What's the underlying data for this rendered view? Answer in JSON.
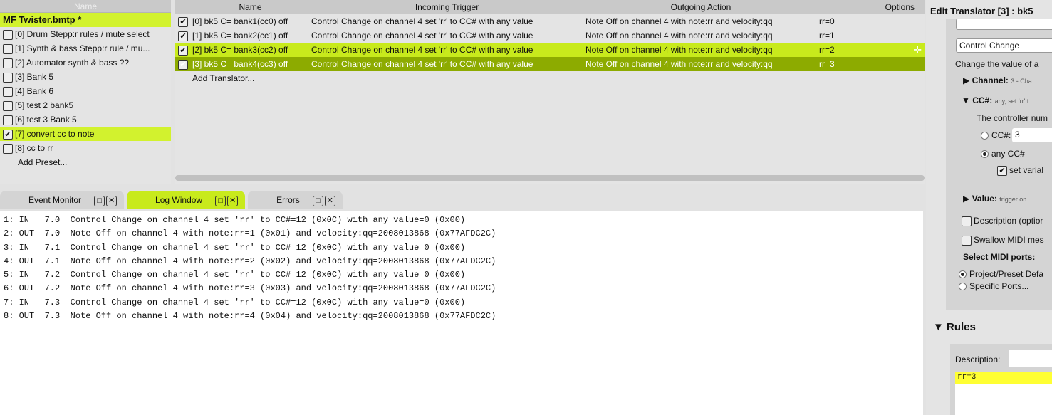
{
  "presets": {
    "header": "Name",
    "project": "MF Twister.bmtp *",
    "items": [
      {
        "label": "[0] Drum Stepp:r rules / mute select",
        "checked": false
      },
      {
        "label": "[1] Synth & bass Stepp:r rule / mu...",
        "checked": false
      },
      {
        "label": "[2] Automator synth & bass ??",
        "checked": false
      },
      {
        "label": "[3] Bank 5",
        "checked": false
      },
      {
        "label": "[4] Bank 6",
        "checked": false
      },
      {
        "label": "[5] test 2 bank5",
        "checked": false
      },
      {
        "label": "[6] test 3 Bank 5",
        "checked": false
      },
      {
        "label": "[7] convert cc to note",
        "checked": true,
        "selected": true
      },
      {
        "label": "[8] cc to rr",
        "checked": false
      }
    ],
    "add_label": "Add Preset..."
  },
  "translators": {
    "columns": [
      "Name",
      "Incoming Trigger",
      "Outgoing Action",
      "Options"
    ],
    "rows": [
      {
        "name": "[0] bk5 C= bank1(cc0) off",
        "incoming": "Control Change on channel 4 set 'rr' to CC# with any value",
        "outgoing": "Note Off on channel 4 with note:rr and velocity:qq",
        "options": "rr=0",
        "checked": true,
        "state": ""
      },
      {
        "name": "[1] bk5 C= bank2(cc1) off",
        "incoming": "Control Change on channel 4 set 'rr' to CC# with any value",
        "outgoing": "Note Off on channel 4 with note:rr and velocity:qq",
        "options": "rr=1",
        "checked": true,
        "state": ""
      },
      {
        "name": "[2] bk5 C= bank3(cc2) off",
        "incoming": "Control Change on channel 4 set 'rr' to CC# with any value",
        "outgoing": "Note Off on channel 4 with note:rr and velocity:qq",
        "options": "rr=2",
        "checked": true,
        "state": "lite"
      },
      {
        "name": "[3] bk5 C= bank4(cc3) off",
        "incoming": "Control Change on channel 4 set 'rr' to CC# with any value",
        "outgoing": "Note Off on channel 4 with note:rr and velocity:qq",
        "options": "rr=3",
        "checked": true,
        "state": "dark"
      }
    ],
    "add_label": "Add Translator..."
  },
  "tabs": [
    {
      "label": "Event Monitor",
      "active": false
    },
    {
      "label": "Log Window",
      "active": true
    },
    {
      "label": "Errors",
      "active": false
    }
  ],
  "log": [
    "1: IN   7.0  Control Change on channel 4 set 'rr' to CC#=12 (0x0C) with any value=0 (0x00)",
    "2: OUT  7.0  Note Off on channel 4 with note:rr=1 (0x01) and velocity:qq=2008013868 (0x77AFDC2C)",
    "3: IN   7.1  Control Change on channel 4 set 'rr' to CC#=12 (0x0C) with any value=0 (0x00)",
    "4: OUT  7.1  Note Off on channel 4 with note:rr=2 (0x02) and velocity:qq=2008013868 (0x77AFDC2C)",
    "5: IN   7.2  Control Change on channel 4 set 'rr' to CC#=12 (0x0C) with any value=0 (0x00)",
    "6: OUT  7.2  Note Off on channel 4 with note:rr=3 (0x03) and velocity:qq=2008013868 (0x77AFDC2C)",
    "7: IN   7.3  Control Change on channel 4 set 'rr' to CC#=12 (0x0C) with any value=0 (0x00)",
    "8: OUT  7.3  Note Off on channel 4 with note:rr=4 (0x04) and velocity:qq=2008013868 (0x77AFDC2C)"
  ],
  "editor": {
    "title": "Edit Translator [3] : bk5",
    "type_select": "Control Change",
    "desc": "Change the value of a",
    "channel_label": "Channel:",
    "channel_value": "3 - Cha",
    "cc_label": "CC#:",
    "cc_value": "any, set 'rr' t",
    "cc_help": "The controller num",
    "cc_radio": "CC#:",
    "cc_input": "3",
    "any_cc": "any CC#",
    "set_var": "set varial",
    "value_label": "Value:",
    "value_value": "trigger on",
    "description_opt": "Description (optior",
    "swallow": "Swallow MIDI mes",
    "ports_label": "Select MIDI ports:",
    "port_default": "Project/Preset Defa",
    "port_specific": "Specific Ports...",
    "rules_label": "Rules",
    "rules_desc_label": "Description:",
    "rules_text": "rr=3"
  },
  "colors": {
    "accent": "#c8ea1c",
    "selected_dark": "#8dab00",
    "rules_highlight": "#ffff33"
  }
}
